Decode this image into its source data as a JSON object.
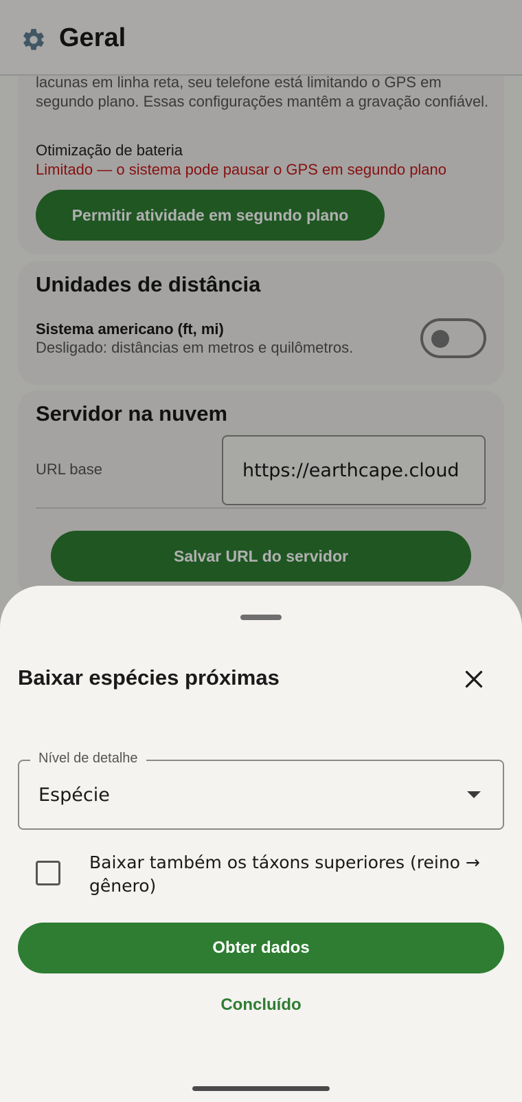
{
  "header": {
    "title": "Geral",
    "icon": "gear-icon"
  },
  "background": {
    "gps_note": "lacunas em linha reta, seu telefone está limitando o GPS em segundo plano. Essas configurações mantêm a gravação confiável.",
    "battery_label": "Otimização de bateria",
    "battery_status": "Limitado — o sistema pode pausar o GPS em segundo plano",
    "allow_background_button": "Permitir atividade em segundo plano",
    "units_title": "Unidades de distância",
    "us_system_label": "Sistema americano (ft, mi)",
    "us_system_desc": "Desligado: distâncias em metros e quilômetros.",
    "us_system_enabled": false,
    "cloud_title": "Servidor na nuvem",
    "base_url_label": "URL base",
    "base_url_value": "https://earthcape.cloud",
    "save_url_button": "Salvar URL do servidor"
  },
  "sheet": {
    "title": "Baixar espécies próximas",
    "detail_level_label": "Nível de detalhe",
    "detail_level_value": "Espécie",
    "higher_taxa_label": "Baixar também os táxons superiores (reino → gênero)",
    "higher_taxa_checked": false,
    "get_data_button": "Obter dados",
    "done_button": "Concluído"
  },
  "colors": {
    "primary": "#2e7d32",
    "warning": "#c21a1a",
    "scrim": "rgba(0,0,0,0.31)"
  }
}
